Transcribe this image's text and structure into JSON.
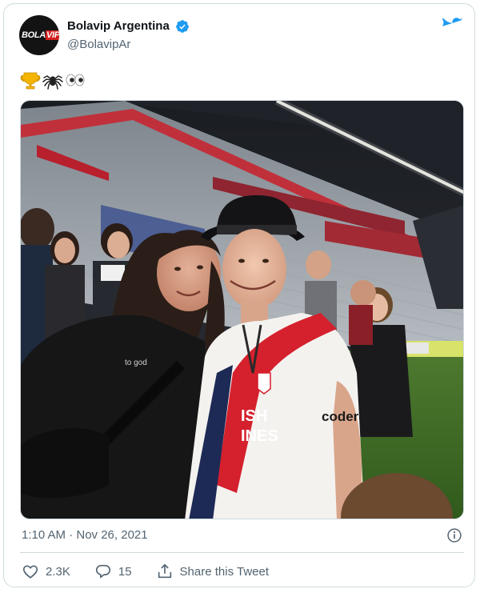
{
  "tweet": {
    "author": {
      "name": "Bolavip Argentina",
      "handle": "@BolavipAr",
      "verified": true,
      "avatar_logo_part1": "BOLA",
      "avatar_logo_part2": "VIP"
    },
    "text_emojis": [
      "trophy-emoji",
      "spider-emoji",
      "eyes-emoji"
    ],
    "photo": {
      "jersey_sponsor_text": "codere",
      "jersey_number_text": "ISH\nINES",
      "tshirt_text": "to god"
    },
    "timestamp": "1:10 AM · Nov 26, 2021",
    "actions": {
      "likes_count": "2.3K",
      "replies_count": "15",
      "share_label": "Share this Tweet"
    }
  },
  "colors": {
    "brand_blue": "#1d9bf0",
    "text_secondary": "#536471",
    "border": "#cfd9de",
    "river_red": "#d5202d"
  }
}
